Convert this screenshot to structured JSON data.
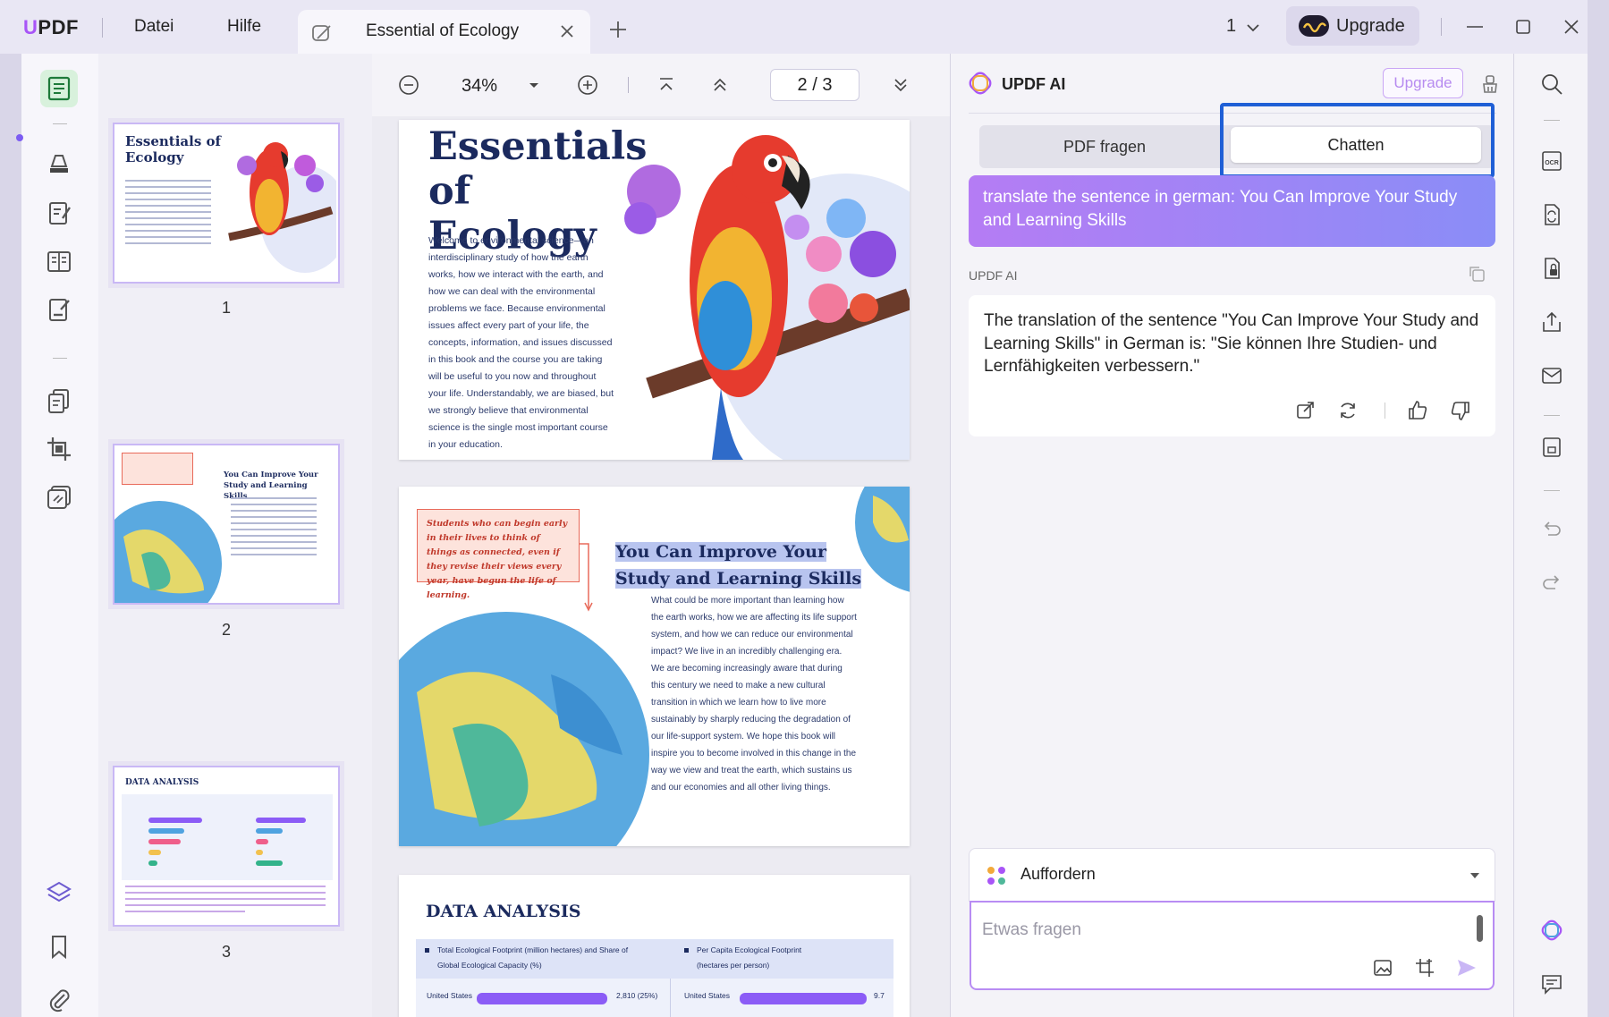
{
  "app": {
    "logo": "UPDF",
    "menu": [
      "Datei",
      "Hilfe"
    ],
    "tab_title": "Essential of Ecology",
    "page_counter": "1",
    "upgrade_label": "Upgrade"
  },
  "thumbnails": {
    "items": [
      {
        "number": "1",
        "title": "Essentials of Ecology"
      },
      {
        "number": "2",
        "title": "You Can Improve Your Study and Learning Skills"
      },
      {
        "number": "3",
        "title": "DATA ANALYSIS"
      }
    ]
  },
  "viewer": {
    "zoom": "34%",
    "page_indicator": "2 / 3",
    "page1": {
      "title": "Essentials of Ecology",
      "body": "Welcome to environmental science—an interdisciplinary study of how the earth works, how we interact with the earth, and how we can deal with the environmental problems we face. Because environmental issues affect every part of your life, the concepts, information, and issues discussed in this book and the course you are taking will be useful to you now and throughout your life. Understandably, we are biased, but we strongly believe that environmental science is the single most important course in your education."
    },
    "page2": {
      "quote": "Students who can begin early in their lives to think of things as connected, even if they revise their views every year, have begun the life of learning.",
      "title_line1": "You Can Improve Your",
      "title_line2": "Study and Learning Skills",
      "body": "What could be more important than learning how the earth works, how we are affecting its life support system, and how we can reduce our environmental impact? We live in an incredibly challenging era. We are becoming increasingly aware that during this century we need to make a new cultural transition in which we learn how to live more sustainably by sharply reducing the degradation of our life-support system. We hope this book will inspire you to become involved in this change in the way we view and treat the earth, which sustains us and our economies and all other living things."
    },
    "page3": {
      "title": "DATA ANALYSIS",
      "col1_header": "Total Ecological Footprint (million hectares) and Share of Global Ecological Capacity (%)",
      "col2_header": "Per Capita Ecological Footprint (hectares per person)",
      "row1_country": "United States",
      "row1_value1": "2,810 (25%)",
      "row1_value2": "9.7"
    }
  },
  "ai_panel": {
    "title": "UPDF AI",
    "upgrade_label": "Upgrade",
    "tab_pdf": "PDF fragen",
    "tab_chat": "Chatten",
    "user_message": "translate the sentence in german: You Can Improve Your Study and Learning Skills",
    "bot_label": "UPDF AI",
    "bot_message": "The translation of the sentence \"You Can Improve Your Study and Learning Skills\" in German is: \"Sie können Ihre Studien- und Lernfähigkeiten verbessern.\"",
    "prompt_label": "Auffordern",
    "ask_placeholder": "Etwas fragen"
  },
  "colors": {
    "accent": "#8b5cf6",
    "highlight_border": "#1f5fd6",
    "heading_navy": "#1b2a5e"
  }
}
